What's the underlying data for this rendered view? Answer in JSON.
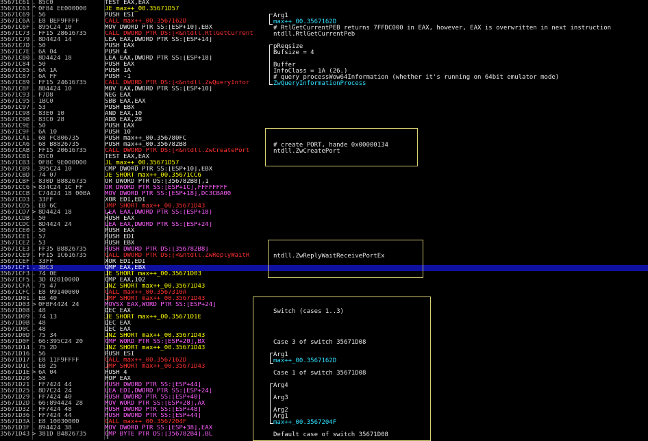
{
  "rows": [
    {
      "addr": "35671C61",
      "mark": ".",
      "hex": "85C0",
      "dis": "TEST EAX,EAX",
      "cls": "c-n"
    },
    {
      "addr": "35671C63",
      "mark": "^",
      "hex": "0F84 EE000000",
      "dis": "JE max++_00.35671D57",
      "cls": "c-j"
    },
    {
      "addr": "35671C69",
      "mark": ".",
      "hex": "56",
      "dis": "PUSH ESI",
      "cls": "c-n"
    },
    {
      "addr": "35671C6A",
      "mark": ".",
      "hex": "E8 BEF9FFFF",
      "dis": "CALL max++_00.3567162D",
      "cls": "c-c"
    },
    {
      "addr": "35671C6F",
      "mark": ".",
      "hex": "895C24 10",
      "dis": "MOV DWORD PTR SS:[ESP+10],EBX",
      "cls": "c-n"
    },
    {
      "addr": "35671C73",
      "mark": ".",
      "hex": "FF15 28616735",
      "dis": "CALL DWORD PTR DS:[<&ntdll.RtlGetCurrent",
      "cls": "c-c"
    },
    {
      "addr": "35671C79",
      "mark": ".",
      "hex": "8D4424 14",
      "dis": "LEA EAX,DWORD PTR SS:[ESP+14]",
      "cls": "c-n"
    },
    {
      "addr": "35671C7D",
      "mark": ".",
      "hex": "50",
      "dis": "PUSH EAX",
      "cls": "c-n"
    },
    {
      "addr": "35671C7E",
      "mark": ".",
      "hex": "6A 04",
      "dis": "PUSH 4",
      "cls": "c-n"
    },
    {
      "addr": "35671C80",
      "mark": ".",
      "hex": "8D4424 18",
      "dis": "LEA EAX,DWORD PTR SS:[ESP+18]",
      "cls": "c-n"
    },
    {
      "addr": "35671C84",
      "mark": ".",
      "hex": "50",
      "dis": "PUSH EAX",
      "cls": "c-n"
    },
    {
      "addr": "35671C85",
      "mark": ".",
      "hex": "6A 1A",
      "dis": "PUSH 1A",
      "cls": "c-n"
    },
    {
      "addr": "35671C87",
      "mark": ".",
      "hex": "6A FF",
      "dis": "PUSH -1",
      "cls": "c-n"
    },
    {
      "addr": "35671C89",
      "mark": ".",
      "hex": "FF15 24616735",
      "dis": "CALL DWORD PTR DS:[<&ntdll.ZwQueryInfor",
      "cls": "c-c"
    },
    {
      "addr": "35671C8F",
      "mark": ".",
      "hex": "8B4424 10",
      "dis": "MOV EAX,DWORD PTR SS:[ESP+10]",
      "cls": "c-n"
    },
    {
      "addr": "35671C93",
      "mark": ".",
      "hex": "F7D8",
      "dis": "NEG EAX",
      "cls": "c-n"
    },
    {
      "addr": "35671C95",
      "mark": ".",
      "hex": "1BC0",
      "dis": "SBB EAX,EAX",
      "cls": "c-n"
    },
    {
      "addr": "35671C97",
      "mark": ".",
      "hex": "53",
      "dis": "PUSH EBX",
      "cls": "c-n"
    },
    {
      "addr": "35671C98",
      "mark": ".",
      "hex": "83E0 10",
      "dis": "AND EAX,10",
      "cls": "c-n"
    },
    {
      "addr": "35671C9B",
      "mark": ".",
      "hex": "83C0 28",
      "dis": "ADD EAX,28",
      "cls": "c-n"
    },
    {
      "addr": "35671C9E",
      "mark": ".",
      "hex": "50",
      "dis": "PUSH EAX",
      "cls": "c-n"
    },
    {
      "addr": "35671C9F",
      "mark": ".",
      "hex": "6A 10",
      "dis": "PUSH 10",
      "cls": "c-n"
    },
    {
      "addr": "35671CA1",
      "mark": ".",
      "hex": "68 FC806735",
      "dis": "PUSH max++_00.356780FC",
      "cls": "c-n"
    },
    {
      "addr": "35671CA6",
      "mark": ".",
      "hex": "68 B8826735",
      "dis": "PUSH max++_00.356782B8",
      "cls": "c-n"
    },
    {
      "addr": "35671CAB",
      "mark": ".",
      "hex": "FF15 20616735",
      "dis": "CALL DWORD PTR DS:[<&ntdll.ZwCreatePort",
      "cls": "c-c"
    },
    {
      "addr": "35671CB1",
      "mark": ".",
      "hex": "85C0",
      "dis": "TEST EAX,EAX",
      "cls": "c-n"
    },
    {
      "addr": "35671CB3",
      "mark": ".",
      "hex": "0F8C 9E000000",
      "dis": "JL max++_00.35671D57",
      "cls": "c-j"
    },
    {
      "addr": "35671CB9",
      "mark": ".",
      "hex": "395C24 10",
      "dis": "CMP DWORD PTR SS:[ESP+10],EBX",
      "cls": "c-n"
    },
    {
      "addr": "35671CBD",
      "mark": ".",
      "hex": "74 07",
      "dis": "JE SHORT max++_00.35671CC6",
      "cls": "c-j"
    },
    {
      "addr": "35671CBF",
      "mark": ".",
      "hex": "830D B8826735",
      "dis": "OR DWORD PTR DS:[356782B8],1",
      "cls": "c-n"
    },
    {
      "addr": "35671CC6",
      "mark": ">",
      "hex": "834C24 1C FF",
      "dis": "OR DWORD PTR SS:[ESP+1C],FFFFFFFF",
      "cls": "c-p"
    },
    {
      "addr": "35671CCB",
      "mark": ".",
      "hex": "C74424 18 00BA",
      "dis": "MOV DWORD PTR SS:[ESP+18],DC3CBA00",
      "cls": "c-p"
    },
    {
      "addr": "35671CD3",
      "mark": ".",
      "hex": "33FF",
      "dis": "XOR EDI,EDI",
      "cls": "c-n"
    },
    {
      "addr": "35671CD5",
      "mark": ".",
      "hex": "EB 6C",
      "dis": "JMP SHORT max++_00.35671D43",
      "cls": "c-c"
    },
    {
      "addr": "35671CD7",
      "mark": ">",
      "hex": "8D4424 18",
      "dis": "LEA EAX,DWORD PTR SS:[ESP+18]",
      "cls": "c-p"
    },
    {
      "addr": "35671CDB",
      "mark": ".",
      "hex": "50",
      "dis": "PUSH EAX",
      "cls": "c-n"
    },
    {
      "addr": "35671CDC",
      "mark": ".",
      "hex": "8D4424 24",
      "dis": "LEA EAX,DWORD PTR SS:[ESP+24]",
      "cls": "c-p"
    },
    {
      "addr": "35671CE0",
      "mark": ".",
      "hex": "50",
      "dis": "PUSH EAX",
      "cls": "c-n"
    },
    {
      "addr": "35671CE1",
      "mark": ".",
      "hex": "57",
      "dis": "PUSH EDI",
      "cls": "c-n"
    },
    {
      "addr": "35671CE2",
      "mark": ".",
      "hex": "53",
      "dis": "PUSH EBX",
      "cls": "c-n"
    },
    {
      "addr": "35671CE3",
      "mark": ".",
      "hex": "FF35 B8826735",
      "dis": "PUSH DWORD PTR DS:[356782B8]",
      "cls": "c-p"
    },
    {
      "addr": "35671CE9",
      "mark": ".",
      "hex": "FF15 1C616735",
      "dis": "CALL DWORD PTR DS:[<&ntdll.ZwReplyWaitR",
      "cls": "c-c"
    },
    {
      "addr": "35671CEF",
      "mark": ".",
      "hex": "33FF",
      "dis": "XOR EDI,EDI",
      "cls": "c-n"
    },
    {
      "addr": "35671CF1",
      "mark": ".",
      "hex": "3BC3",
      "dis": "CMP EAX,EBX",
      "cls": "c-k"
    },
    {
      "addr": "35671CF3",
      "mark": ".",
      "hex": "74 0E",
      "dis": "JE SHORT max++_00.35671D03",
      "cls": "c-j"
    },
    {
      "addr": "35671CF5",
      "mark": ".",
      "hex": "3D 02010000",
      "dis": "CMP EAX,102",
      "cls": "c-n"
    },
    {
      "addr": "35671CFA",
      "mark": ".",
      "hex": "75 47",
      "dis": "JNZ SHORT max++_00.35671D43",
      "cls": "c-j"
    },
    {
      "addr": "35671CFC",
      "mark": ".",
      "hex": "E8 09140000",
      "dis": "CALL max++_00.3567310A",
      "cls": "c-c"
    },
    {
      "addr": "35671D01",
      "mark": ".",
      "hex": "EB 40",
      "dis": "JMP SHORT max++_00.35671D43",
      "cls": "c-c"
    },
    {
      "addr": "35671D03",
      "mark": ">",
      "hex": "0FBF4424 24",
      "dis": "MOVSX EAX,WORD PTR SS:[ESP+24]",
      "cls": "c-p"
    },
    {
      "addr": "35671D08",
      "mark": ".",
      "hex": "48",
      "dis": "DEC EAX",
      "cls": "c-n"
    },
    {
      "addr": "35671D09",
      "mark": ".",
      "hex": "74 13",
      "dis": "JE SHORT max++_00.35671D1E",
      "cls": "c-j"
    },
    {
      "addr": "35671D0B",
      "mark": ".",
      "hex": "48",
      "dis": "DEC EAX",
      "cls": "c-n"
    },
    {
      "addr": "35671D0C",
      "mark": ".",
      "hex": "48",
      "dis": "DEC EAX",
      "cls": "c-n"
    },
    {
      "addr": "35671D0D",
      "mark": ".",
      "hex": "75 34",
      "dis": "JNZ SHORT max++_00.35671D43",
      "cls": "c-j"
    },
    {
      "addr": "35671D0F",
      "mark": ".",
      "hex": "66:395C24 20",
      "dis": "CMP WORD PTR SS:[ESP+20],BX",
      "cls": "c-p"
    },
    {
      "addr": "35671D14",
      "mark": ".",
      "hex": "75 2D",
      "dis": "JNZ SHORT max++_00.35671D43",
      "cls": "c-j"
    },
    {
      "addr": "35671D16",
      "mark": ".",
      "hex": "56",
      "dis": "PUSH ESI",
      "cls": "c-n"
    },
    {
      "addr": "35671D17",
      "mark": ".",
      "hex": "E8 11F9FFFF",
      "dis": "CALL max++_00.3567162D",
      "cls": "c-c"
    },
    {
      "addr": "35671D1C",
      "mark": ".",
      "hex": "EB 25",
      "dis": "JMP SHORT max++_00.35671D43",
      "cls": "c-c"
    },
    {
      "addr": "35671D1E",
      "mark": ">",
      "hex": "6A 04",
      "dis": "PUSH 4",
      "cls": "c-n"
    },
    {
      "addr": "35671D20",
      "mark": ".",
      "hex": "58",
      "dis": "POP EAX",
      "cls": "c-n"
    },
    {
      "addr": "35671D21",
      "mark": ".",
      "hex": "FF7424 44",
      "dis": "PUSH DWORD PTR SS:[ESP+44]",
      "cls": "c-p"
    },
    {
      "addr": "35671D25",
      "mark": ".",
      "hex": "8D7C24 24",
      "dis": "LEA EDI,DWORD PTR SS:[ESP+24]",
      "cls": "c-p"
    },
    {
      "addr": "35671D29",
      "mark": ".",
      "hex": "FF7424 40",
      "dis": "PUSH DWORD PTR SS:[ESP+40]",
      "cls": "c-p"
    },
    {
      "addr": "35671D2D",
      "mark": ".",
      "hex": "66:894424 28",
      "dis": "MOV WORD PTR SS:[ESP+28],AX",
      "cls": "c-p"
    },
    {
      "addr": "35671D32",
      "mark": ".",
      "hex": "FF7424 48",
      "dis": "PUSH DWORD PTR SS:[ESP+48]",
      "cls": "c-p"
    },
    {
      "addr": "35671D36",
      "mark": ".",
      "hex": "FF7424 44",
      "dis": "PUSH DWORD PTR SS:[ESP+44]",
      "cls": "c-p"
    },
    {
      "addr": "35671D3A",
      "mark": ".",
      "hex": "E8 10030000",
      "dis": "CALL max++_00.3567204F",
      "cls": "c-c"
    },
    {
      "addr": "35671D3F",
      "mark": ".",
      "hex": "894424 38",
      "dis": "MOV DWORD PTR SS:[ESP+38],EAX",
      "cls": "c-p"
    },
    {
      "addr": "35671D43",
      "mark": ">",
      "hex": "381D B4826735",
      "dis": "CMP BYTE PTR DS:[356782B4],BL",
      "cls": "c-p"
    }
  ],
  "selected_index": 43,
  "comments": {
    "arg1_a": "Arg1",
    "arg1_a_target": "max++_00.3567162D",
    "rtl_note": "# RtlGetCurrentPEB returns 7FFDC000 in EAX, however, EAX is overwritten in next instruction",
    "rtl_name": "ntdll.RtlGetCurrentPeb",
    "preqsize": "pReqsize",
    "bufsize": "Bufsize = 4",
    "buffer": "Buffer",
    "infoclass": "InfoClass = 1A (26.)",
    "query_note": "# query processWow64Information (whether it's running on 64bit emulator mode)",
    "zwquery": "ZwQueryInformationProcess",
    "createport_note": "# create PORT, hande 0x00000134",
    "createport_name": "ntdll.ZwCreatePort",
    "replywait_name": "ntdll.ZwReplyWaitReceivePortEx",
    "switch_cases": "Switch (cases 1..3)",
    "case3": "Case 3 of switch 35671D08",
    "arg1_b": "Arg1",
    "arg1_b_target": "max++_00.3567162D",
    "case1": "Case 1 of switch 35671D08",
    "arg4": "Arg4",
    "arg3": "Arg3",
    "arg2": "Arg2",
    "arg1_c": "Arg1",
    "arg1_c_target": "max++_00.3567204F",
    "default_case": "Default case of switch 35671D08"
  },
  "colors": {
    "background": "#000000",
    "selection": "#1010a0",
    "jump": "#ffff00",
    "call": "#ff3030",
    "memory": "#ff60ff",
    "api_comment": "#30e0ff",
    "box_border": "#d8d070"
  }
}
